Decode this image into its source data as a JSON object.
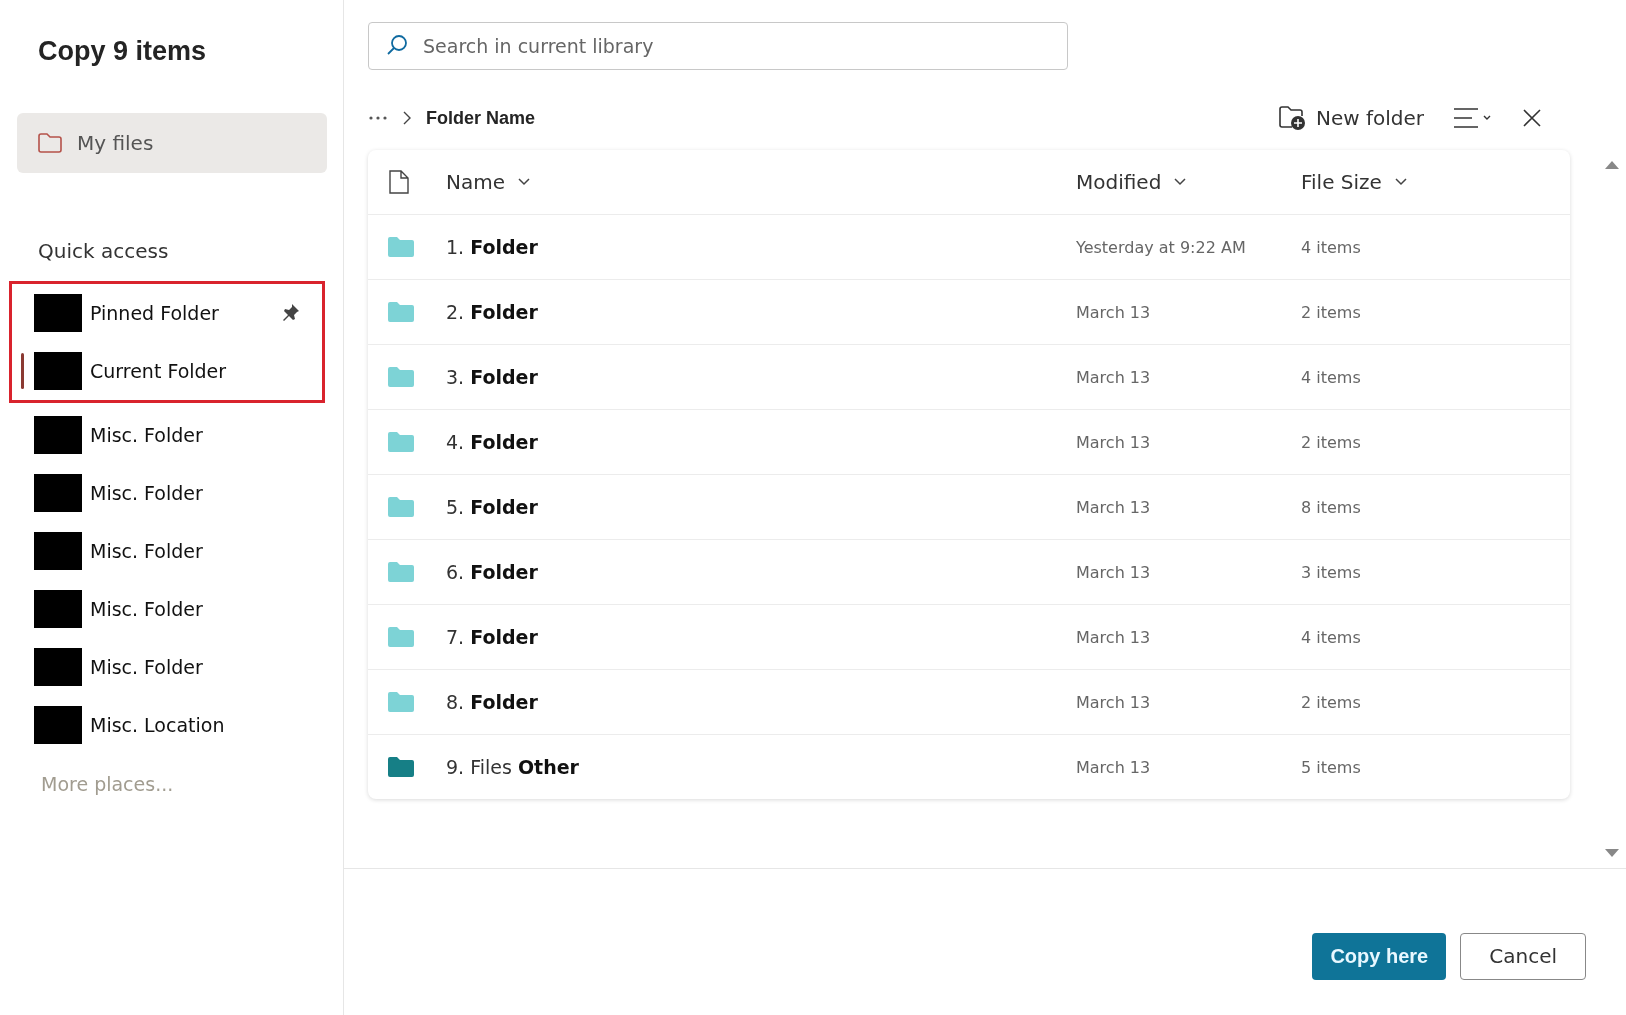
{
  "title": "Copy 9 items",
  "my_files": {
    "label": "My files",
    "selected": true
  },
  "quick_access": {
    "heading": "Quick access",
    "items": [
      {
        "label": "Pinned Folder",
        "pinned": true,
        "selected": false,
        "highlighted": true
      },
      {
        "label": "Current Folder",
        "pinned": false,
        "selected": true,
        "highlighted": true
      },
      {
        "label": "Misc. Folder",
        "pinned": false,
        "selected": false,
        "highlighted": false
      },
      {
        "label": "Misc. Folder",
        "pinned": false,
        "selected": false,
        "highlighted": false
      },
      {
        "label": "Misc. Folder",
        "pinned": false,
        "selected": false,
        "highlighted": false
      },
      {
        "label": "Misc. Folder",
        "pinned": false,
        "selected": false,
        "highlighted": false
      },
      {
        "label": "Misc. Folder",
        "pinned": false,
        "selected": false,
        "highlighted": false
      },
      {
        "label": "Misc. Location",
        "pinned": false,
        "selected": false,
        "highlighted": false
      }
    ],
    "more": "More places..."
  },
  "search": {
    "placeholder": "Search in current library"
  },
  "breadcrumb": {
    "current": "Folder Name"
  },
  "toolbar": {
    "new_folder": "New folder"
  },
  "table": {
    "columns": [
      "Name",
      "Modified",
      "File Size"
    ],
    "rows": [
      {
        "name": "1. **Folder**",
        "modified": "Yesterday at 9:22 AM",
        "size": "4 items",
        "color": "#7dd3d6"
      },
      {
        "name": "2. **Folder**",
        "modified": "March 13",
        "size": "2 items",
        "color": "#7dd3d6"
      },
      {
        "name": "3. **Folder**",
        "modified": "March 13",
        "size": "4 items",
        "color": "#7dd3d6"
      },
      {
        "name": "4. **Folder**",
        "modified": "March 13",
        "size": "2 items",
        "color": "#7dd3d6"
      },
      {
        "name": "5. **Folder**",
        "modified": "March 13",
        "size": "8 items",
        "color": "#7dd3d6"
      },
      {
        "name": "6. **Folder**",
        "modified": "March 13",
        "size": "3 items",
        "color": "#7dd3d6"
      },
      {
        "name": "7. **Folder**",
        "modified": "March 13",
        "size": "4 items",
        "color": "#7dd3d6"
      },
      {
        "name": "8. **Folder**",
        "modified": "March 13",
        "size": "2 items",
        "color": "#7dd3d6"
      },
      {
        "name": "9. Files **Other**",
        "modified": "March 13",
        "size": "5 items",
        "color": "#167f86"
      }
    ]
  },
  "buttons": {
    "primary": "Copy here",
    "secondary": "Cancel"
  }
}
